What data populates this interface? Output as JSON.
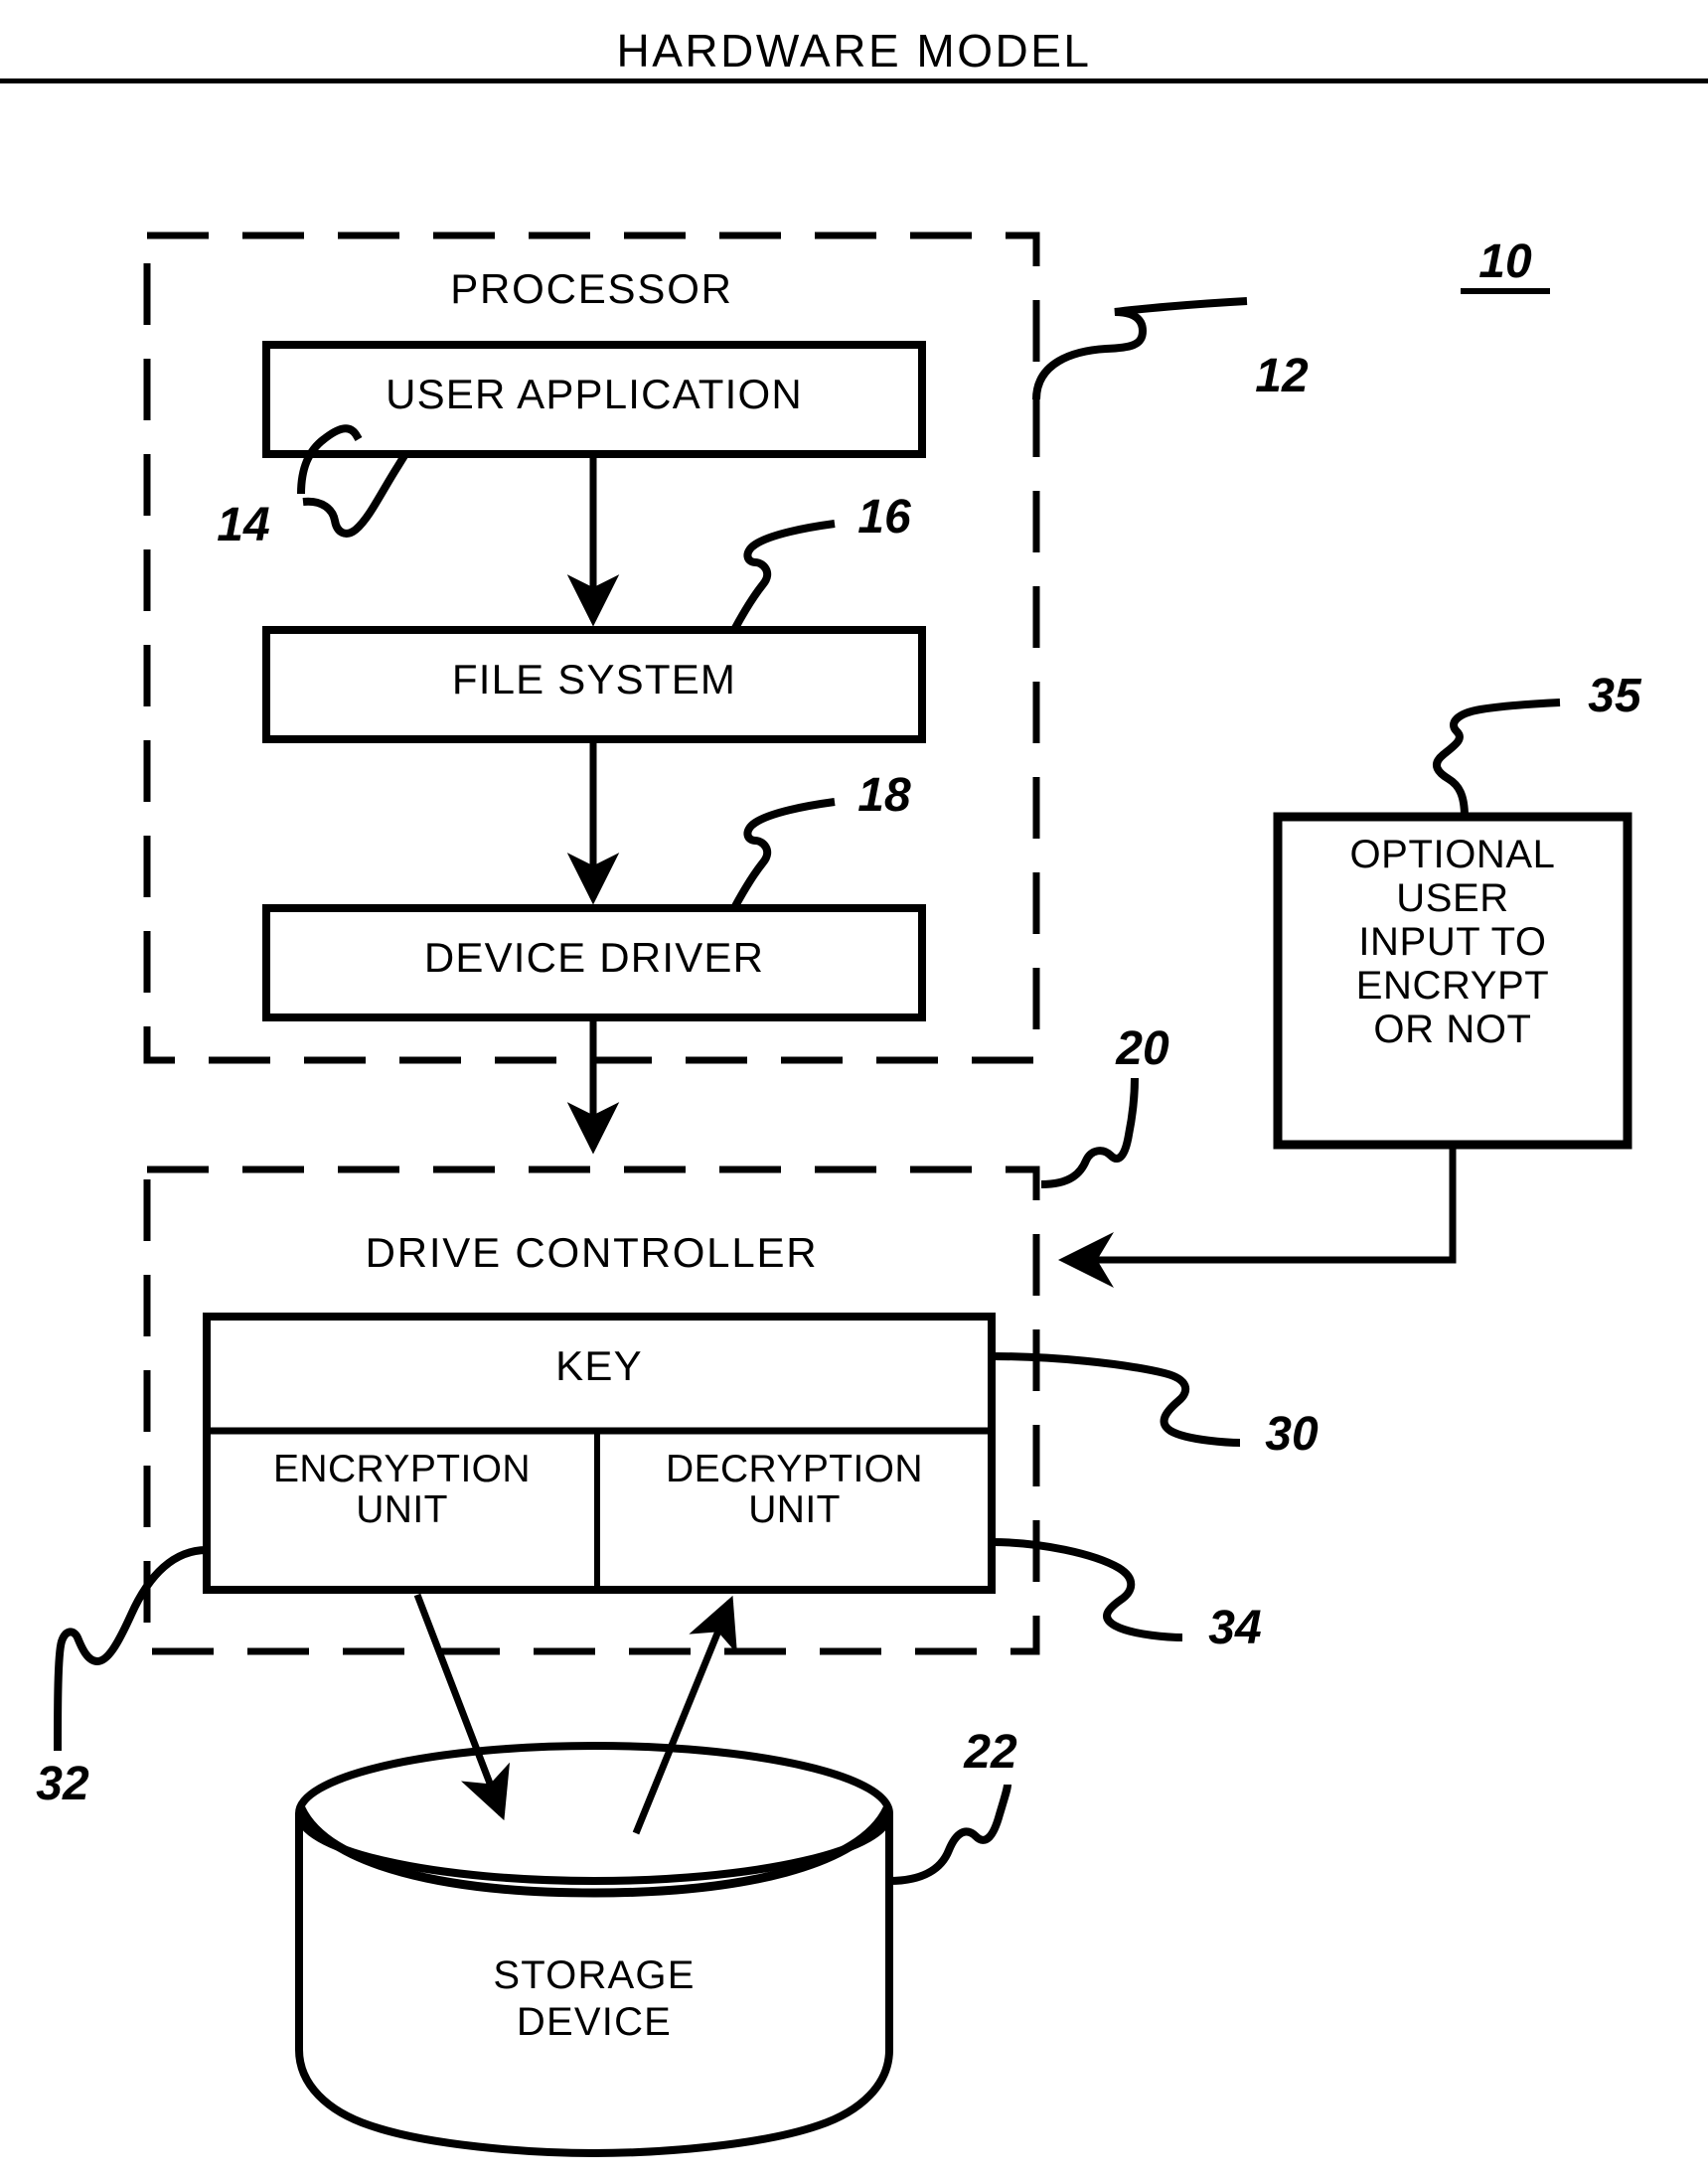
{
  "figure": {
    "title": "HARDWARE MODEL",
    "overall_ref": "10"
  },
  "processor": {
    "section_label": "PROCESSOR",
    "ref": "12",
    "blocks": [
      {
        "label": "USER APPLICATION",
        "ref": "14"
      },
      {
        "label": "FILE SYSTEM",
        "ref": "16"
      },
      {
        "label": "DEVICE DRIVER",
        "ref": "18"
      }
    ]
  },
  "optional_input": {
    "ref": "35",
    "lines": [
      "OPTIONAL",
      "USER",
      "INPUT TO",
      "ENCRYPT",
      "OR NOT"
    ],
    "text": "OPTIONAL USER INPUT TO ENCRYPT OR NOT"
  },
  "drive_controller": {
    "section_label": "DRIVE CONTROLLER",
    "ref": "20",
    "key": {
      "label": "KEY",
      "ref": "30"
    },
    "encryption_unit": {
      "line1": "ENCRYPTION",
      "line2": "UNIT",
      "ref": "32"
    },
    "decryption_unit": {
      "line1": "DECRYPTION",
      "line2": "UNIT",
      "ref": "34"
    }
  },
  "storage_device": {
    "line1": "STORAGE",
    "line2": "DEVICE",
    "ref": "22"
  },
  "colors": {
    "ink": "#000000",
    "paper": "#ffffff"
  }
}
